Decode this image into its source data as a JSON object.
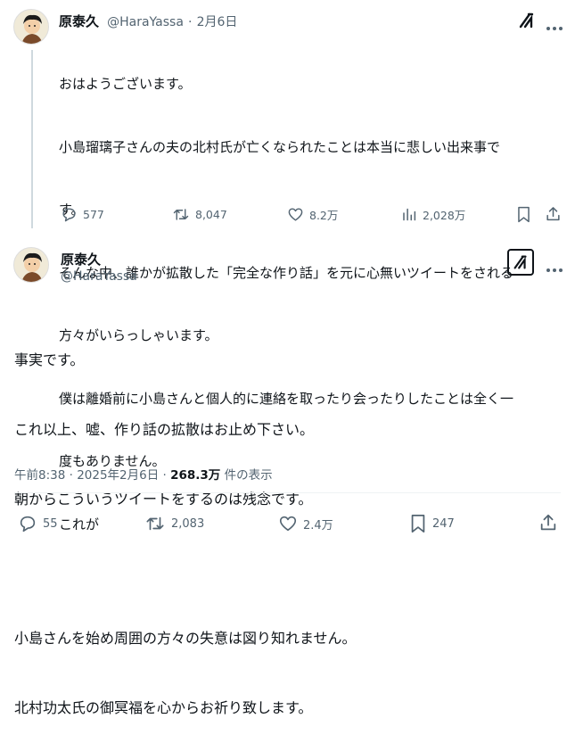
{
  "tweet1": {
    "author_name": "原泰久",
    "author_handle": "@HaraYassa",
    "separator": "·",
    "date": "2月6日",
    "lines": [
      "おはようございます。",
      "小島瑠璃子さんの夫の北村氏が亡くなられたことは本当に悲しい出来事で",
      "す。",
      "そんな中、誰かが拡散した「完全な作り話」を元に心無いツイートをされる",
      "方々がいらっしゃいます。",
      "僕は離婚前に小島さんと個人的に連絡を取ったり会ったりしたことは全く一",
      "度もありません。",
      "これが"
    ],
    "actions": {
      "replies": "577",
      "retweets": "8,047",
      "likes": "8.2万",
      "views": "2,028万"
    }
  },
  "tweet2": {
    "author_name": "原泰久",
    "author_handle": "@HaraYassa",
    "lines": [
      "事実です。",
      "これ以上、嘘、作り話の拡散はお止め下さい。",
      "朝からこういうツイートをするのは残念です。",
      "",
      "小島さんを始め周囲の方々の失意は図り知れません。",
      "北村功太氏の御冥福を心からお祈り致します。"
    ],
    "timestamp": "午前8:38 · 2025年2月6日 · ",
    "view_count": "268.3万",
    "view_suffix": " 件の表示",
    "actions": {
      "replies": "55",
      "retweets": "2,083",
      "likes": "2.4万",
      "bookmarks": "247"
    }
  },
  "icons": {
    "grok": "grok-icon",
    "more": "more-icon",
    "reply": "reply-icon",
    "retweet": "retweet-icon",
    "like": "heart-icon",
    "views": "views-icon",
    "bookmark": "bookmark-icon",
    "share": "share-icon"
  },
  "colors": {
    "text": "#0f1419",
    "secondary": "#536471",
    "thread_line": "#cfd9de"
  }
}
